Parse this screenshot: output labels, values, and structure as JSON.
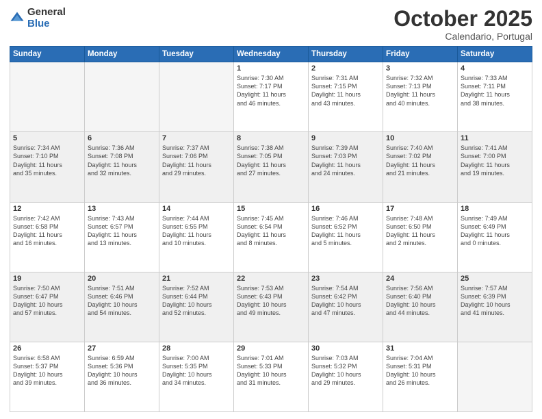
{
  "logo": {
    "general": "General",
    "blue": "Blue"
  },
  "header": {
    "month": "October 2025",
    "location": "Calendario, Portugal"
  },
  "days_of_week": [
    "Sunday",
    "Monday",
    "Tuesday",
    "Wednesday",
    "Thursday",
    "Friday",
    "Saturday"
  ],
  "weeks": [
    [
      {
        "day": "",
        "info": ""
      },
      {
        "day": "",
        "info": ""
      },
      {
        "day": "",
        "info": ""
      },
      {
        "day": "1",
        "info": "Sunrise: 7:30 AM\nSunset: 7:17 PM\nDaylight: 11 hours\nand 46 minutes."
      },
      {
        "day": "2",
        "info": "Sunrise: 7:31 AM\nSunset: 7:15 PM\nDaylight: 11 hours\nand 43 minutes."
      },
      {
        "day": "3",
        "info": "Sunrise: 7:32 AM\nSunset: 7:13 PM\nDaylight: 11 hours\nand 40 minutes."
      },
      {
        "day": "4",
        "info": "Sunrise: 7:33 AM\nSunset: 7:11 PM\nDaylight: 11 hours\nand 38 minutes."
      }
    ],
    [
      {
        "day": "5",
        "info": "Sunrise: 7:34 AM\nSunset: 7:10 PM\nDaylight: 11 hours\nand 35 minutes."
      },
      {
        "day": "6",
        "info": "Sunrise: 7:36 AM\nSunset: 7:08 PM\nDaylight: 11 hours\nand 32 minutes."
      },
      {
        "day": "7",
        "info": "Sunrise: 7:37 AM\nSunset: 7:06 PM\nDaylight: 11 hours\nand 29 minutes."
      },
      {
        "day": "8",
        "info": "Sunrise: 7:38 AM\nSunset: 7:05 PM\nDaylight: 11 hours\nand 27 minutes."
      },
      {
        "day": "9",
        "info": "Sunrise: 7:39 AM\nSunset: 7:03 PM\nDaylight: 11 hours\nand 24 minutes."
      },
      {
        "day": "10",
        "info": "Sunrise: 7:40 AM\nSunset: 7:02 PM\nDaylight: 11 hours\nand 21 minutes."
      },
      {
        "day": "11",
        "info": "Sunrise: 7:41 AM\nSunset: 7:00 PM\nDaylight: 11 hours\nand 19 minutes."
      }
    ],
    [
      {
        "day": "12",
        "info": "Sunrise: 7:42 AM\nSunset: 6:58 PM\nDaylight: 11 hours\nand 16 minutes."
      },
      {
        "day": "13",
        "info": "Sunrise: 7:43 AM\nSunset: 6:57 PM\nDaylight: 11 hours\nand 13 minutes."
      },
      {
        "day": "14",
        "info": "Sunrise: 7:44 AM\nSunset: 6:55 PM\nDaylight: 11 hours\nand 10 minutes."
      },
      {
        "day": "15",
        "info": "Sunrise: 7:45 AM\nSunset: 6:54 PM\nDaylight: 11 hours\nand 8 minutes."
      },
      {
        "day": "16",
        "info": "Sunrise: 7:46 AM\nSunset: 6:52 PM\nDaylight: 11 hours\nand 5 minutes."
      },
      {
        "day": "17",
        "info": "Sunrise: 7:48 AM\nSunset: 6:50 PM\nDaylight: 11 hours\nand 2 minutes."
      },
      {
        "day": "18",
        "info": "Sunrise: 7:49 AM\nSunset: 6:49 PM\nDaylight: 11 hours\nand 0 minutes."
      }
    ],
    [
      {
        "day": "19",
        "info": "Sunrise: 7:50 AM\nSunset: 6:47 PM\nDaylight: 10 hours\nand 57 minutes."
      },
      {
        "day": "20",
        "info": "Sunrise: 7:51 AM\nSunset: 6:46 PM\nDaylight: 10 hours\nand 54 minutes."
      },
      {
        "day": "21",
        "info": "Sunrise: 7:52 AM\nSunset: 6:44 PM\nDaylight: 10 hours\nand 52 minutes."
      },
      {
        "day": "22",
        "info": "Sunrise: 7:53 AM\nSunset: 6:43 PM\nDaylight: 10 hours\nand 49 minutes."
      },
      {
        "day": "23",
        "info": "Sunrise: 7:54 AM\nSunset: 6:42 PM\nDaylight: 10 hours\nand 47 minutes."
      },
      {
        "day": "24",
        "info": "Sunrise: 7:56 AM\nSunset: 6:40 PM\nDaylight: 10 hours\nand 44 minutes."
      },
      {
        "day": "25",
        "info": "Sunrise: 7:57 AM\nSunset: 6:39 PM\nDaylight: 10 hours\nand 41 minutes."
      }
    ],
    [
      {
        "day": "26",
        "info": "Sunrise: 6:58 AM\nSunset: 5:37 PM\nDaylight: 10 hours\nand 39 minutes."
      },
      {
        "day": "27",
        "info": "Sunrise: 6:59 AM\nSunset: 5:36 PM\nDaylight: 10 hours\nand 36 minutes."
      },
      {
        "day": "28",
        "info": "Sunrise: 7:00 AM\nSunset: 5:35 PM\nDaylight: 10 hours\nand 34 minutes."
      },
      {
        "day": "29",
        "info": "Sunrise: 7:01 AM\nSunset: 5:33 PM\nDaylight: 10 hours\nand 31 minutes."
      },
      {
        "day": "30",
        "info": "Sunrise: 7:03 AM\nSunset: 5:32 PM\nDaylight: 10 hours\nand 29 minutes."
      },
      {
        "day": "31",
        "info": "Sunrise: 7:04 AM\nSunset: 5:31 PM\nDaylight: 10 hours\nand 26 minutes."
      },
      {
        "day": "",
        "info": ""
      }
    ]
  ]
}
